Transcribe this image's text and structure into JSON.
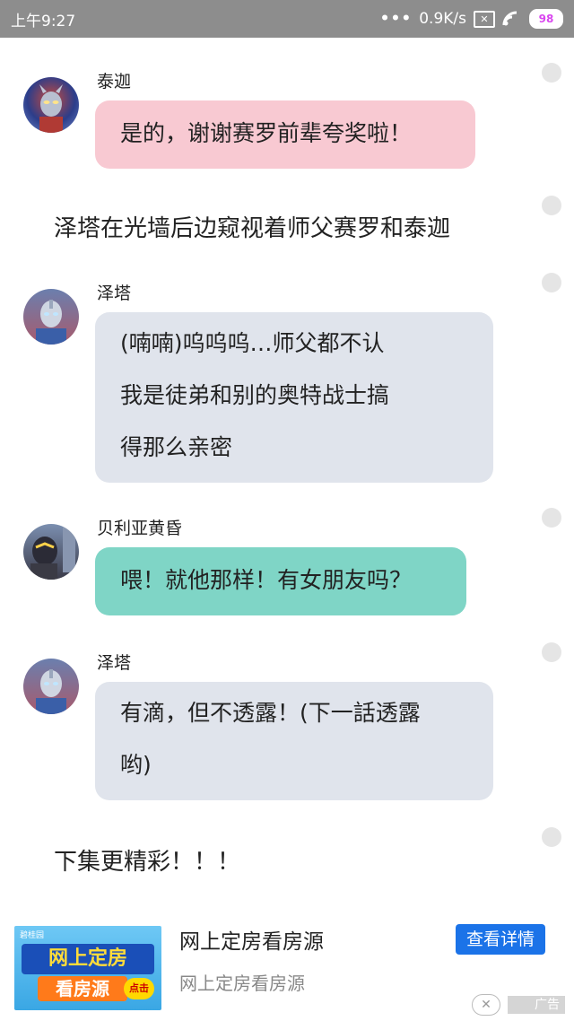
{
  "status_bar": {
    "time": "上午9:27",
    "net_speed": "0.9K/s",
    "battery": "98",
    "sim_glyph": "✕"
  },
  "messages": [
    {
      "speaker": "泰迦",
      "text": [
        "是的，谢谢赛罗前辈夸奖啦！"
      ],
      "style": "pink",
      "avatar": "taiga-avatar"
    },
    {
      "narration": "泽塔在光墙后边窥视着师父赛罗和泰迦"
    },
    {
      "speaker": "泽塔",
      "text": [
        "(喃喃)呜呜呜…师父都不认",
        "我是徒弟和别的奥特战士搞",
        "得那么亲密"
      ],
      "style": "gray",
      "avatar": "z-avatar"
    },
    {
      "speaker": "贝利亚黄昏",
      "text": [
        "喂！就他那样！有女朋友吗？"
      ],
      "style": "teal",
      "avatar": "belial-avatar"
    },
    {
      "speaker": "泽塔",
      "text": [
        "有滴，但不透露！(下一話透露",
        "哟)"
      ],
      "style": "gray",
      "avatar": "z-avatar"
    },
    {
      "narration": "下集更精彩！！！"
    }
  ],
  "ad": {
    "title": "网上定房看房源",
    "subtitle": "网上定房看房源",
    "button": "查看详情",
    "label": "广告",
    "close": "✕",
    "image_line1": "网上定房",
    "image_line2": "看房源",
    "image_click": "点击",
    "image_brand": "碧桂园"
  },
  "colors": {
    "pink": "#f8c9d2",
    "gray": "#e0e4ec",
    "teal": "#7fd5c6",
    "status_bar": "#8d8d8d",
    "ad_button": "#1b73e8"
  }
}
